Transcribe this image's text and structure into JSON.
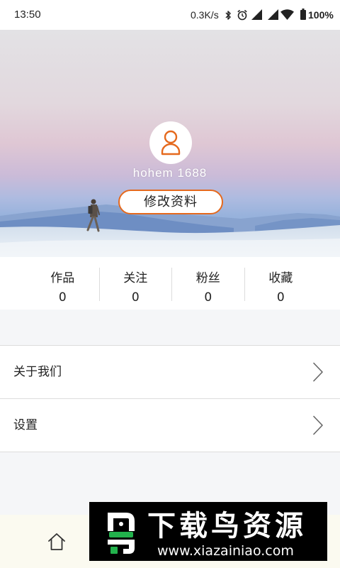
{
  "status_bar": {
    "time": "13:50",
    "net_speed": "0.3K/s",
    "battery": "100%",
    "icons": [
      "bluetooth-icon",
      "alarm-icon",
      "hd-signal-icon",
      "signal-icon",
      "wifi-icon",
      "battery-icon"
    ]
  },
  "profile": {
    "avatar_icon": "user-icon",
    "username": "hohem 1688",
    "edit_button": "修改资料"
  },
  "stats": [
    {
      "label": "作品",
      "value": "0"
    },
    {
      "label": "关注",
      "value": "0"
    },
    {
      "label": "粉丝",
      "value": "0"
    },
    {
      "label": "收藏",
      "value": "0"
    }
  ],
  "menu": [
    {
      "label": "关于我们",
      "icon": "chevron-right-icon"
    },
    {
      "label": "设置",
      "icon": "chevron-right-icon"
    }
  ],
  "bottom_nav": {
    "items": [
      {
        "icon": "home-icon"
      }
    ]
  },
  "watermark": {
    "title": "下载鸟资源",
    "url": "www.xiazainiao.com"
  },
  "colors": {
    "accent": "#e5691d",
    "page_background": "#f5f6f8",
    "card_background": "#ffffff",
    "divider": "#dcdcdc",
    "bottom_nav_background": "#fbfaf0",
    "text": "#222222"
  }
}
